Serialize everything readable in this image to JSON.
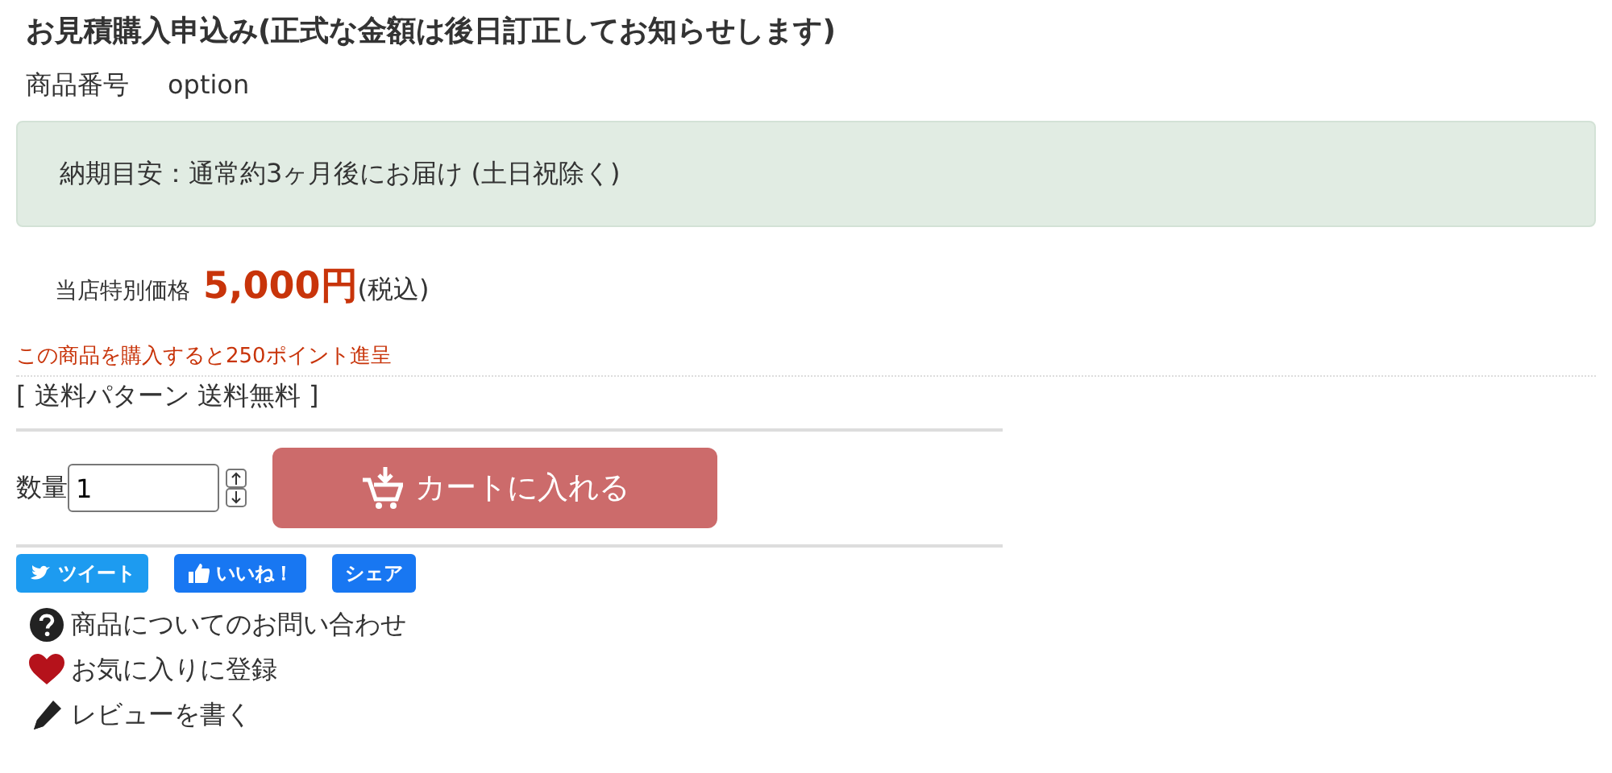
{
  "title": "お見積購入申込み(正式な金額は後日訂正してお知らせします)",
  "product_number": {
    "label": "商品番号",
    "value": "option"
  },
  "delivery_notice": "納期目安：通常約3ヶ月後にお届け (土日祝除く)",
  "price": {
    "label": "当店特別価格",
    "amount": "5,000円",
    "tax": "(税込)"
  },
  "points": "この商品を購入すると250ポイント進呈",
  "shipping": "[ 送料パターン 送料無料 ]",
  "quantity": {
    "label": "数量",
    "value": "1"
  },
  "cart_button": "カートに入れる",
  "social": [
    {
      "kind": "tweet",
      "label": "ツイート"
    },
    {
      "kind": "like",
      "label": "いいね！"
    },
    {
      "kind": "share",
      "label": "シェア"
    }
  ],
  "links": [
    {
      "kind": "question",
      "label": "商品についてのお問い合わせ"
    },
    {
      "kind": "heart",
      "label": "お気に入りに登録"
    },
    {
      "kind": "pencil",
      "label": "レビューを書く"
    }
  ]
}
